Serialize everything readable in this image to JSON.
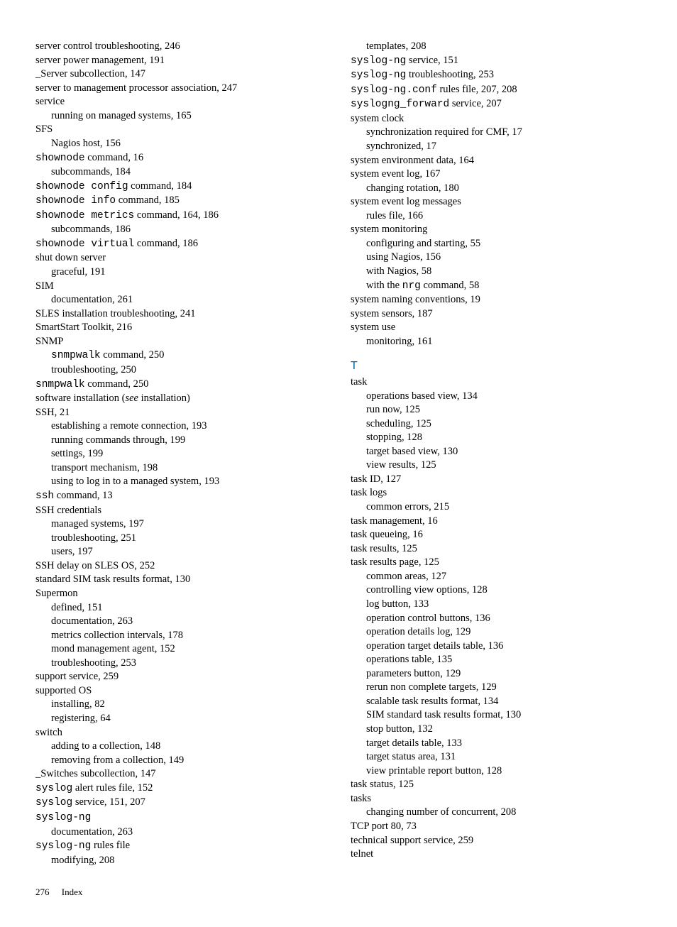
{
  "footer": {
    "page": "276",
    "label": "Index"
  },
  "left": [
    {
      "t": "server control troubleshooting, 246"
    },
    {
      "t": "server power management, 191"
    },
    {
      "t": "_Server subcollection, 147"
    },
    {
      "t": "server to management processor association, 247"
    },
    {
      "t": "service"
    },
    {
      "t": "running on managed systems, 165",
      "i": 1
    },
    {
      "t": "SFS"
    },
    {
      "t": "Nagios host, 156",
      "i": 1
    },
    {
      "seg": [
        {
          "m": true,
          "v": "shownode"
        },
        {
          "v": " command, 16"
        }
      ]
    },
    {
      "t": "subcommands, 184",
      "i": 1
    },
    {
      "seg": [
        {
          "m": true,
          "v": "shownode config"
        },
        {
          "v": " command, 184"
        }
      ]
    },
    {
      "seg": [
        {
          "m": true,
          "v": "shownode info"
        },
        {
          "v": " command, 185"
        }
      ]
    },
    {
      "seg": [
        {
          "m": true,
          "v": "shownode metrics"
        },
        {
          "v": " command, 164, 186"
        }
      ]
    },
    {
      "t": "subcommands, 186",
      "i": 1
    },
    {
      "seg": [
        {
          "m": true,
          "v": "shownode virtual"
        },
        {
          "v": " command, 186"
        }
      ]
    },
    {
      "t": "shut down server"
    },
    {
      "t": "graceful, 191",
      "i": 1
    },
    {
      "t": "SIM"
    },
    {
      "t": "documentation, 261",
      "i": 1
    },
    {
      "t": "SLES installation troubleshooting, 241"
    },
    {
      "t": "SmartStart Toolkit, 216"
    },
    {
      "t": "SNMP"
    },
    {
      "seg": [
        {
          "m": true,
          "v": "snmpwalk"
        },
        {
          "v": " command, 250"
        }
      ],
      "i": 1
    },
    {
      "t": "troubleshooting, 250",
      "i": 1
    },
    {
      "seg": [
        {
          "m": true,
          "v": "snmpwalk"
        },
        {
          "v": " command, 250"
        }
      ]
    },
    {
      "seg": [
        {
          "v": "software installation ("
        },
        {
          "it": true,
          "v": "see"
        },
        {
          "v": " installation)"
        }
      ]
    },
    {
      "t": "SSH, 21"
    },
    {
      "t": "establishing a remote connection, 193",
      "i": 1
    },
    {
      "t": "running commands through, 199",
      "i": 1
    },
    {
      "t": "settings, 199",
      "i": 1
    },
    {
      "t": "transport mechanism, 198",
      "i": 1
    },
    {
      "t": "using to log in to a managed system, 193",
      "i": 1
    },
    {
      "seg": [
        {
          "m": true,
          "v": "ssh"
        },
        {
          "v": " command, 13"
        }
      ]
    },
    {
      "t": "SSH credentials"
    },
    {
      "t": "managed systems, 197",
      "i": 1
    },
    {
      "t": "troubleshooting, 251",
      "i": 1
    },
    {
      "t": "users, 197",
      "i": 1
    },
    {
      "t": "SSH delay on SLES OS, 252"
    },
    {
      "t": "standard SIM task results format, 130"
    },
    {
      "t": "Supermon"
    },
    {
      "t": "defined, 151",
      "i": 1
    },
    {
      "t": "documentation, 263",
      "i": 1
    },
    {
      "t": "metrics collection intervals, 178",
      "i": 1
    },
    {
      "t": "mond management agent, 152",
      "i": 1
    },
    {
      "t": "troubleshooting, 253",
      "i": 1
    },
    {
      "t": "support service, 259"
    },
    {
      "t": "supported OS"
    },
    {
      "t": "installing, 82",
      "i": 1
    },
    {
      "t": "registering, 64",
      "i": 1
    },
    {
      "t": "switch"
    },
    {
      "t": "adding to a collection, 148",
      "i": 1
    },
    {
      "t": "removing from a collection, 149",
      "i": 1
    },
    {
      "t": "_Switches subcollection, 147"
    },
    {
      "seg": [
        {
          "m": true,
          "v": "syslog"
        },
        {
          "v": " alert rules file, 152"
        }
      ]
    },
    {
      "seg": [
        {
          "m": true,
          "v": "syslog"
        },
        {
          "v": " service, 151, 207"
        }
      ]
    },
    {
      "seg": [
        {
          "m": true,
          "v": "syslog-ng"
        }
      ]
    },
    {
      "t": "documentation, 263",
      "i": 1
    },
    {
      "seg": [
        {
          "m": true,
          "v": "syslog-ng"
        },
        {
          "v": " rules file"
        }
      ]
    },
    {
      "t": "modifying, 208",
      "i": 1
    }
  ],
  "right": [
    {
      "t": "templates, 208",
      "i": 1
    },
    {
      "seg": [
        {
          "m": true,
          "v": "syslog-ng"
        },
        {
          "v": " service, 151"
        }
      ]
    },
    {
      "seg": [
        {
          "m": true,
          "v": "syslog-ng"
        },
        {
          "v": " troubleshooting, 253"
        }
      ]
    },
    {
      "seg": [
        {
          "m": true,
          "v": "syslog-ng.conf"
        },
        {
          "v": " rules file, 207, 208"
        }
      ]
    },
    {
      "seg": [
        {
          "m": true,
          "v": "syslogng_forward"
        },
        {
          "v": " service, 207"
        }
      ]
    },
    {
      "t": "system clock"
    },
    {
      "t": "synchronization required for CMF, 17",
      "i": 1
    },
    {
      "t": "synchronized, 17",
      "i": 1
    },
    {
      "t": "system environment data, 164"
    },
    {
      "t": "system event log, 167"
    },
    {
      "t": "changing rotation, 180",
      "i": 1
    },
    {
      "t": "system event log messages"
    },
    {
      "t": "rules file, 166",
      "i": 1
    },
    {
      "t": "system monitoring"
    },
    {
      "t": "configuring and starting, 55",
      "i": 1
    },
    {
      "t": "using Nagios, 156",
      "i": 1
    },
    {
      "t": "with Nagios, 58",
      "i": 1
    },
    {
      "seg": [
        {
          "v": "with the "
        },
        {
          "m": true,
          "v": "nrg"
        },
        {
          "v": " command, 58"
        }
      ],
      "i": 1
    },
    {
      "t": "system naming conventions, 19"
    },
    {
      "t": "system sensors, 187"
    },
    {
      "t": "system use"
    },
    {
      "t": "monitoring, 161",
      "i": 1
    },
    {
      "letter": "T"
    },
    {
      "t": "task"
    },
    {
      "t": "operations based view, 134",
      "i": 1
    },
    {
      "t": "run now, 125",
      "i": 1
    },
    {
      "t": "scheduling, 125",
      "i": 1
    },
    {
      "t": "stopping, 128",
      "i": 1
    },
    {
      "t": "target based view, 130",
      "i": 1
    },
    {
      "t": "view results, 125",
      "i": 1
    },
    {
      "t": "task ID, 127"
    },
    {
      "t": "task logs"
    },
    {
      "t": "common errors, 215",
      "i": 1
    },
    {
      "t": "task management, 16"
    },
    {
      "t": "task queueing, 16"
    },
    {
      "t": "task results, 125"
    },
    {
      "t": "task results page, 125"
    },
    {
      "t": "common areas, 127",
      "i": 1
    },
    {
      "t": "controlling view options, 128",
      "i": 1
    },
    {
      "t": "log button, 133",
      "i": 1
    },
    {
      "t": "operation control buttons, 136",
      "i": 1
    },
    {
      "t": "operation details log, 129",
      "i": 1
    },
    {
      "t": "operation target details table, 136",
      "i": 1
    },
    {
      "t": "operations table, 135",
      "i": 1
    },
    {
      "t": "parameters button, 129",
      "i": 1
    },
    {
      "t": "rerun non complete targets, 129",
      "i": 1
    },
    {
      "t": "scalable task results format, 134",
      "i": 1
    },
    {
      "t": "SIM standard task results format, 130",
      "i": 1
    },
    {
      "t": "stop button, 132",
      "i": 1
    },
    {
      "t": "target details table, 133",
      "i": 1
    },
    {
      "t": "target status area, 131",
      "i": 1
    },
    {
      "t": "view printable report button, 128",
      "i": 1
    },
    {
      "t": "task status, 125"
    },
    {
      "t": "tasks"
    },
    {
      "t": "changing number of concurrent, 208",
      "i": 1
    },
    {
      "t": "TCP port 80, 73"
    },
    {
      "t": "technical support service, 259"
    },
    {
      "t": "telnet"
    }
  ]
}
